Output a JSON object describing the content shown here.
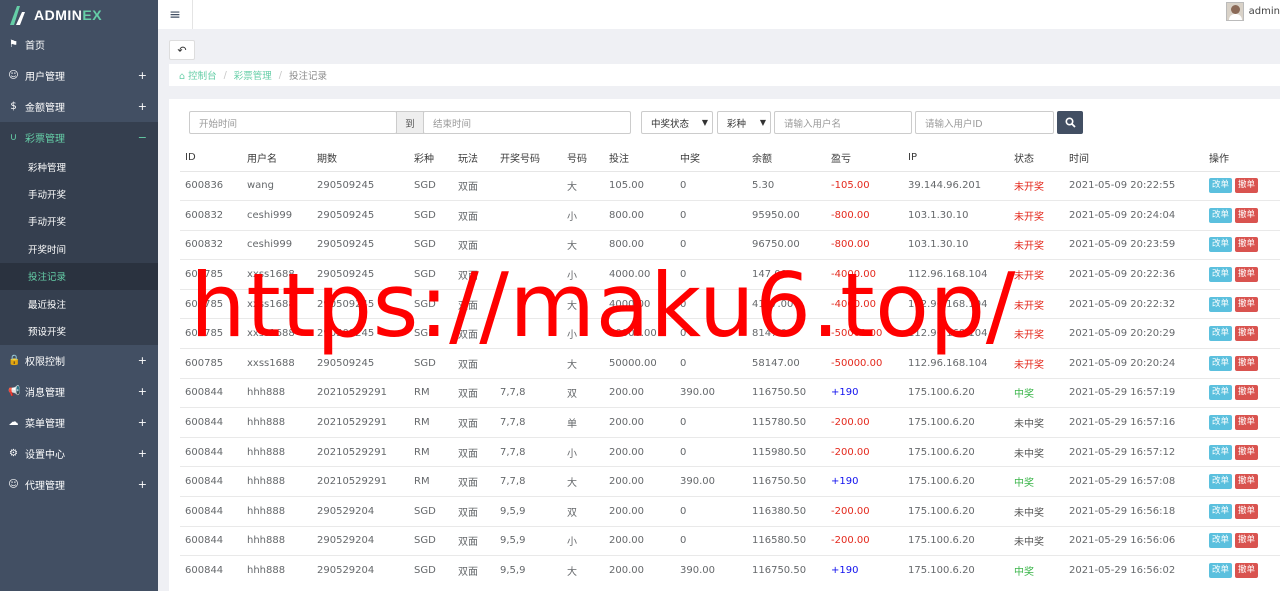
{
  "brand": {
    "prefix": "ADMIN",
    "accent": "EX"
  },
  "colors": {
    "sidebar": "#424f63",
    "sidebar_active": "#353f4f",
    "accent": "#65cea7",
    "negative": "#e4291d",
    "positive": "#1111ee",
    "edit_button": "#5bc0de",
    "undo_button": "#d9534f"
  },
  "sidebar": {
    "items": [
      {
        "label": "首页",
        "icon": "flag-icon",
        "glyph": "⚑",
        "plus": ""
      },
      {
        "label": "用户管理",
        "icon": "users-icon",
        "glyph": "☺",
        "plus": "+"
      },
      {
        "label": "金额管理",
        "icon": "dollar-icon",
        "glyph": "$",
        "plus": "+"
      },
      {
        "label": "彩票管理",
        "icon": "magnet-icon",
        "glyph": "∪",
        "plus": "−"
      },
      {
        "label": "权限控制",
        "icon": "lock-icon",
        "glyph": "🔒",
        "plus": "+"
      },
      {
        "label": "消息管理",
        "icon": "bullhorn-icon",
        "glyph": "📢",
        "plus": "+"
      },
      {
        "label": "菜单管理",
        "icon": "cloud-icon",
        "glyph": "☁",
        "plus": "+"
      },
      {
        "label": "设置中心",
        "icon": "gear-icon",
        "glyph": "⚙",
        "plus": "+"
      },
      {
        "label": "代理管理",
        "icon": "smile-icon",
        "glyph": "☺",
        "plus": "+"
      }
    ],
    "submenu": [
      "彩种管理",
      "手动开奖",
      "手动开奖",
      "开奖时间",
      "投注记录",
      "最近投注",
      "预设开奖"
    ]
  },
  "header": {
    "menu_icon": "≡",
    "username": "admin"
  },
  "back_icon": "↶",
  "breadcrumb": {
    "home": "控制台",
    "parent": "彩票管理",
    "current": "投注记录"
  },
  "filters": {
    "start_placeholder": "开始时间",
    "to_label": "到",
    "end_placeholder": "结束时间",
    "status_select": "中奖状态",
    "lottery_select": "彩种",
    "username_placeholder": "请输入用户名",
    "userid_placeholder": "请输入用户ID"
  },
  "table": {
    "columns": [
      "ID",
      "用户名",
      "期数",
      "彩种",
      "玩法",
      "开奖号码",
      "号码",
      "投注",
      "中奖",
      "余额",
      "盈亏",
      "IP",
      "状态",
      "时间",
      "操作"
    ],
    "edit_label": "改单",
    "undo_label": "撤单",
    "rows": [
      {
        "id": "600836",
        "user": "wang",
        "issue": "290509245",
        "lottery": "SGD",
        "play": "双面",
        "draw": "",
        "num": "大",
        "bet": "105.00",
        "win": "0",
        "balance": "5.30",
        "pl": "-105.00",
        "pl_type": "neg",
        "ip": "39.144.96.201",
        "status": "未开奖",
        "status_type": "red",
        "time": "2021-05-09 20:22:55"
      },
      {
        "id": "600832",
        "user": "ceshi999",
        "issue": "290509245",
        "lottery": "SGD",
        "play": "双面",
        "draw": "",
        "num": "小",
        "bet": "800.00",
        "win": "0",
        "balance": "95950.00",
        "pl": "-800.00",
        "pl_type": "neg",
        "ip": "103.1.30.10",
        "status": "未开奖",
        "status_type": "red",
        "time": "2021-05-09 20:24:04"
      },
      {
        "id": "600832",
        "user": "ceshi999",
        "issue": "290509245",
        "lottery": "SGD",
        "play": "双面",
        "draw": "",
        "num": "大",
        "bet": "800.00",
        "win": "0",
        "balance": "96750.00",
        "pl": "-800.00",
        "pl_type": "neg",
        "ip": "103.1.30.10",
        "status": "未开奖",
        "status_type": "red",
        "time": "2021-05-09 20:23:59"
      },
      {
        "id": "600785",
        "user": "xxss1688",
        "issue": "290509245",
        "lottery": "SGD",
        "play": "双面",
        "draw": "",
        "num": "小",
        "bet": "4000.00",
        "win": "0",
        "balance": "147.00",
        "pl": "-4000.00",
        "pl_type": "neg",
        "ip": "112.96.168.104",
        "status": "未开奖",
        "status_type": "red",
        "time": "2021-05-09 20:22:36"
      },
      {
        "id": "600785",
        "user": "xxss1688",
        "issue": "290509245",
        "lottery": "SGD",
        "play": "双面",
        "draw": "",
        "num": "大",
        "bet": "4000.00",
        "win": "0",
        "balance": "4147.00",
        "pl": "-4000.00",
        "pl_type": "neg",
        "ip": "112.96.168.104",
        "status": "未开奖",
        "status_type": "red",
        "time": "2021-05-09 20:22:32"
      },
      {
        "id": "600785",
        "user": "xxss1688",
        "issue": "290509245",
        "lottery": "SGD",
        "play": "双面",
        "draw": "",
        "num": "小",
        "bet": "50000.00",
        "win": "0",
        "balance": "8147.00",
        "pl": "-50000.00",
        "pl_type": "neg",
        "ip": "112.96.168.104",
        "status": "未开奖",
        "status_type": "red",
        "time": "2021-05-09 20:20:29"
      },
      {
        "id": "600785",
        "user": "xxss1688",
        "issue": "290509245",
        "lottery": "SGD",
        "play": "双面",
        "draw": "",
        "num": "大",
        "bet": "50000.00",
        "win": "0",
        "balance": "58147.00",
        "pl": "-50000.00",
        "pl_type": "neg",
        "ip": "112.96.168.104",
        "status": "未开奖",
        "status_type": "red",
        "time": "2021-05-09 20:20:24"
      },
      {
        "id": "600844",
        "user": "hhh888",
        "issue": "20210529291",
        "lottery": "RM",
        "play": "双面",
        "draw": "7,7,8",
        "num": "双",
        "bet": "200.00",
        "win": "390.00",
        "balance": "116750.50",
        "pl": "+190",
        "pl_type": "pos",
        "ip": "175.100.6.20",
        "status": "中奖",
        "status_type": "green",
        "time": "2021-05-29 16:57:19"
      },
      {
        "id": "600844",
        "user": "hhh888",
        "issue": "20210529291",
        "lottery": "RM",
        "play": "双面",
        "draw": "7,7,8",
        "num": "单",
        "bet": "200.00",
        "win": "0",
        "balance": "115780.50",
        "pl": "-200.00",
        "pl_type": "neg",
        "ip": "175.100.6.20",
        "status": "未中奖",
        "status_type": "gray",
        "time": "2021-05-29 16:57:16"
      },
      {
        "id": "600844",
        "user": "hhh888",
        "issue": "20210529291",
        "lottery": "RM",
        "play": "双面",
        "draw": "7,7,8",
        "num": "小",
        "bet": "200.00",
        "win": "0",
        "balance": "115980.50",
        "pl": "-200.00",
        "pl_type": "neg",
        "ip": "175.100.6.20",
        "status": "未中奖",
        "status_type": "gray",
        "time": "2021-05-29 16:57:12"
      },
      {
        "id": "600844",
        "user": "hhh888",
        "issue": "20210529291",
        "lottery": "RM",
        "play": "双面",
        "draw": "7,7,8",
        "num": "大",
        "bet": "200.00",
        "win": "390.00",
        "balance": "116750.50",
        "pl": "+190",
        "pl_type": "pos",
        "ip": "175.100.6.20",
        "status": "中奖",
        "status_type": "green",
        "time": "2021-05-29 16:57:08"
      },
      {
        "id": "600844",
        "user": "hhh888",
        "issue": "290529204",
        "lottery": "SGD",
        "play": "双面",
        "draw": "9,5,9",
        "num": "双",
        "bet": "200.00",
        "win": "0",
        "balance": "116380.50",
        "pl": "-200.00",
        "pl_type": "neg",
        "ip": "175.100.6.20",
        "status": "未中奖",
        "status_type": "gray",
        "time": "2021-05-29 16:56:18"
      },
      {
        "id": "600844",
        "user": "hhh888",
        "issue": "290529204",
        "lottery": "SGD",
        "play": "双面",
        "draw": "9,5,9",
        "num": "小",
        "bet": "200.00",
        "win": "0",
        "balance": "116580.50",
        "pl": "-200.00",
        "pl_type": "neg",
        "ip": "175.100.6.20",
        "status": "未中奖",
        "status_type": "gray",
        "time": "2021-05-29 16:56:06"
      },
      {
        "id": "600844",
        "user": "hhh888",
        "issue": "290529204",
        "lottery": "SGD",
        "play": "双面",
        "draw": "9,5,9",
        "num": "大",
        "bet": "200.00",
        "win": "390.00",
        "balance": "116750.50",
        "pl": "+190",
        "pl_type": "pos",
        "ip": "175.100.6.20",
        "status": "中奖",
        "status_type": "green",
        "time": "2021-05-29 16:56:02"
      }
    ]
  },
  "watermark": "https://maku6.top/"
}
